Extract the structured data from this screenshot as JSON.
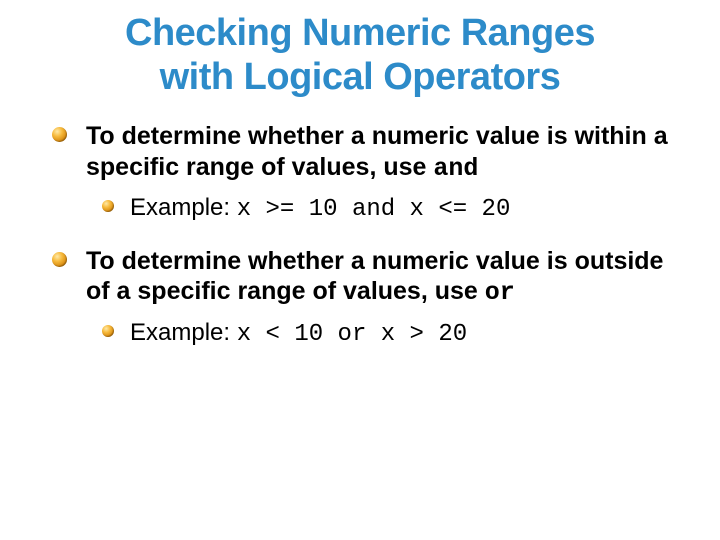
{
  "title_line1": "Checking Numeric Ranges",
  "title_line2": "with Logical Operators",
  "bullets": [
    {
      "text": "To determine whether a numeric value is within a specific range of values, use ",
      "code_tail": "and",
      "example_label": "Example: ",
      "example_code": "x >= 10 and x <= 20"
    },
    {
      "text": "To determine whether a numeric value is outside of a specific range of values, use ",
      "code_tail": "or",
      "example_label": "Example: ",
      "example_code": "x < 10 or x > 20"
    }
  ]
}
